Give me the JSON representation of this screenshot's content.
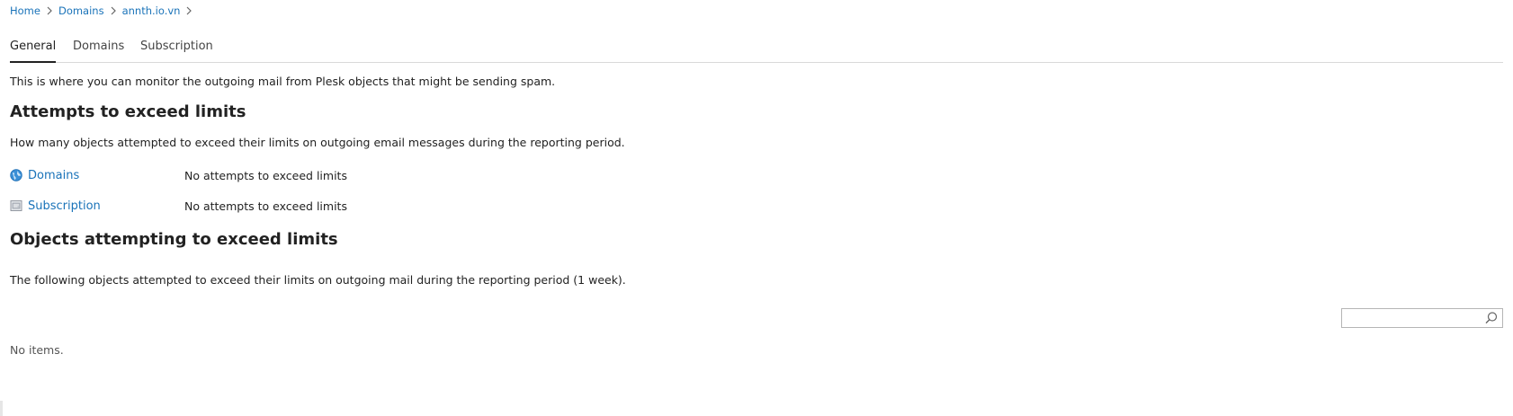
{
  "breadcrumb": {
    "items": [
      "Home",
      "Domains",
      "annth.io.vn"
    ]
  },
  "tabs": [
    {
      "label": "General",
      "active": true
    },
    {
      "label": "Domains",
      "active": false
    },
    {
      "label": "Subscription",
      "active": false
    }
  ],
  "intro": "This is where you can monitor the outgoing mail from Plesk objects that might be sending spam.",
  "attempts": {
    "heading": "Attempts to exceed limits",
    "description": "How many objects attempted to exceed their limits on outgoing email messages during the reporting period.",
    "rows": [
      {
        "label": "Domains",
        "value": "No attempts to exceed limits",
        "icon": "globe-icon"
      },
      {
        "label": "Subscription",
        "value": "No attempts to exceed limits",
        "icon": "subscription-icon"
      }
    ]
  },
  "objects": {
    "heading": "Objects attempting to exceed limits",
    "description": "The following objects attempted to exceed their limits on outgoing mail during the reporting period (1 week).",
    "search_value": "",
    "empty_text": "No items."
  },
  "colors": {
    "link": "#1a73b9",
    "text": "#222222",
    "border": "#d9d9d9"
  }
}
